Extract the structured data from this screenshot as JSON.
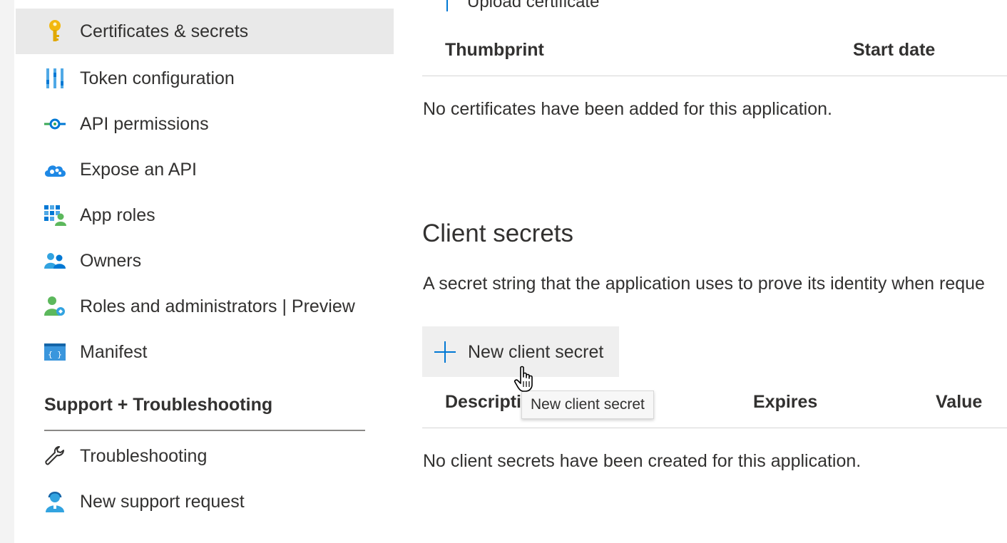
{
  "sidebar": {
    "items": [
      {
        "label": "Certificates & secrets",
        "icon": "key-icon",
        "active": true
      },
      {
        "label": "Token configuration",
        "icon": "token-config-icon"
      },
      {
        "label": "API permissions",
        "icon": "api-permissions-icon"
      },
      {
        "label": "Expose an API",
        "icon": "cloud-api-icon"
      },
      {
        "label": "App roles",
        "icon": "app-roles-icon"
      },
      {
        "label": "Owners",
        "icon": "owners-icon"
      },
      {
        "label": "Roles and administrators | Preview",
        "icon": "roles-admin-icon"
      },
      {
        "label": "Manifest",
        "icon": "manifest-icon"
      }
    ],
    "support_section": {
      "title": "Support + Troubleshooting",
      "items": [
        {
          "label": "Troubleshooting",
          "icon": "wrench-icon"
        },
        {
          "label": "New support request",
          "icon": "support-person-icon"
        }
      ]
    }
  },
  "certificates": {
    "upload_label": "Upload certificate",
    "columns": [
      "Thumbprint",
      "Start date"
    ],
    "empty_message": "No certificates have been added for this application."
  },
  "client_secrets": {
    "title": "Client secrets",
    "description": "A secret string that the application uses to prove its identity when reque",
    "new_button_label": "New client secret",
    "tooltip": "New client secret",
    "columns": [
      "Descripti",
      "Expires",
      "Value"
    ],
    "empty_message": "No client secrets have been created for this application."
  },
  "colors": {
    "accent": "#0078d4",
    "active_bg": "#e9e9e9",
    "text": "#323130"
  }
}
